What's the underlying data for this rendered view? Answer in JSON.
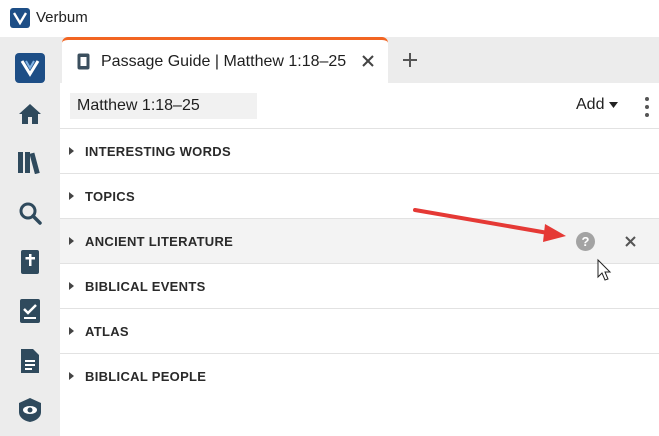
{
  "window": {
    "app_title": "Verbum"
  },
  "rail": {
    "items": [
      "verbum-logo",
      "home-icon",
      "library-icon",
      "search-icon",
      "bible-icon",
      "checklist-icon",
      "document-icon",
      "eye-icon"
    ]
  },
  "tabs": {
    "active_label": "Passage Guide | Matthew 1:18–25",
    "new_tab": "+"
  },
  "toolbar": {
    "reference_value": "Matthew 1:18–25",
    "add_label": "Add"
  },
  "sections": [
    {
      "label": "INTERESTING WORDS"
    },
    {
      "label": "TOPICS"
    },
    {
      "label": "ANCIENT LITERATURE",
      "hover": true
    },
    {
      "label": "BIBLICAL EVENTS"
    },
    {
      "label": "ATLAS"
    },
    {
      "label": "BIBLICAL PEOPLE"
    }
  ],
  "help_icon_glyph": "?",
  "colors": {
    "brand": "#1d4e86",
    "active_tab_accent": "#f26522",
    "annotation_arrow": "#e53935"
  }
}
